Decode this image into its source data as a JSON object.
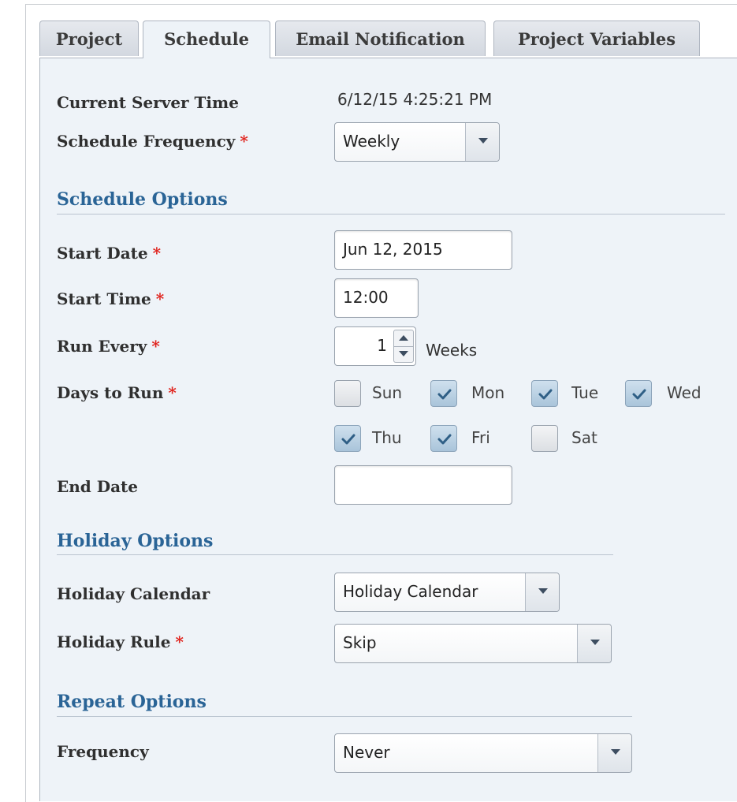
{
  "tabs": [
    {
      "label": "Project",
      "active": false
    },
    {
      "label": "Schedule",
      "active": true
    },
    {
      "label": "Email Notification",
      "active": false
    },
    {
      "label": "Project Variables",
      "active": false
    }
  ],
  "form": {
    "server_time_label": "Current Server Time",
    "server_time_value": "6/12/15 4:25:21 PM",
    "frequency_label": "Schedule Frequency",
    "frequency_value": "Weekly",
    "required_marker": "*"
  },
  "schedule_options": {
    "heading": "Schedule Options",
    "start_date_label": "Start Date",
    "start_date_value": "Jun 12, 2015",
    "start_time_label": "Start Time",
    "start_time_value": "12:00",
    "run_every_label": "Run Every",
    "run_every_value": "1",
    "run_every_unit": "Weeks",
    "days_label": "Days to Run",
    "days": [
      {
        "label": "Sun",
        "checked": false
      },
      {
        "label": "Mon",
        "checked": true
      },
      {
        "label": "Tue",
        "checked": true
      },
      {
        "label": "Wed",
        "checked": true
      },
      {
        "label": "Thu",
        "checked": true
      },
      {
        "label": "Fri",
        "checked": true
      },
      {
        "label": "Sat",
        "checked": false
      }
    ],
    "end_date_label": "End Date",
    "end_date_value": ""
  },
  "holiday_options": {
    "heading": "Holiday Options",
    "calendar_label": "Holiday Calendar",
    "calendar_value": "Holiday Calendar",
    "rule_label": "Holiday Rule",
    "rule_value": "Skip"
  },
  "repeat_options": {
    "heading": "Repeat Options",
    "frequency_label": "Frequency",
    "frequency_value": "Never"
  },
  "colors": {
    "section_heading": "#2a6496",
    "required": "#e0201a",
    "panel_background": "#eef3f8",
    "checkbox_checked": "#a9c4da"
  }
}
